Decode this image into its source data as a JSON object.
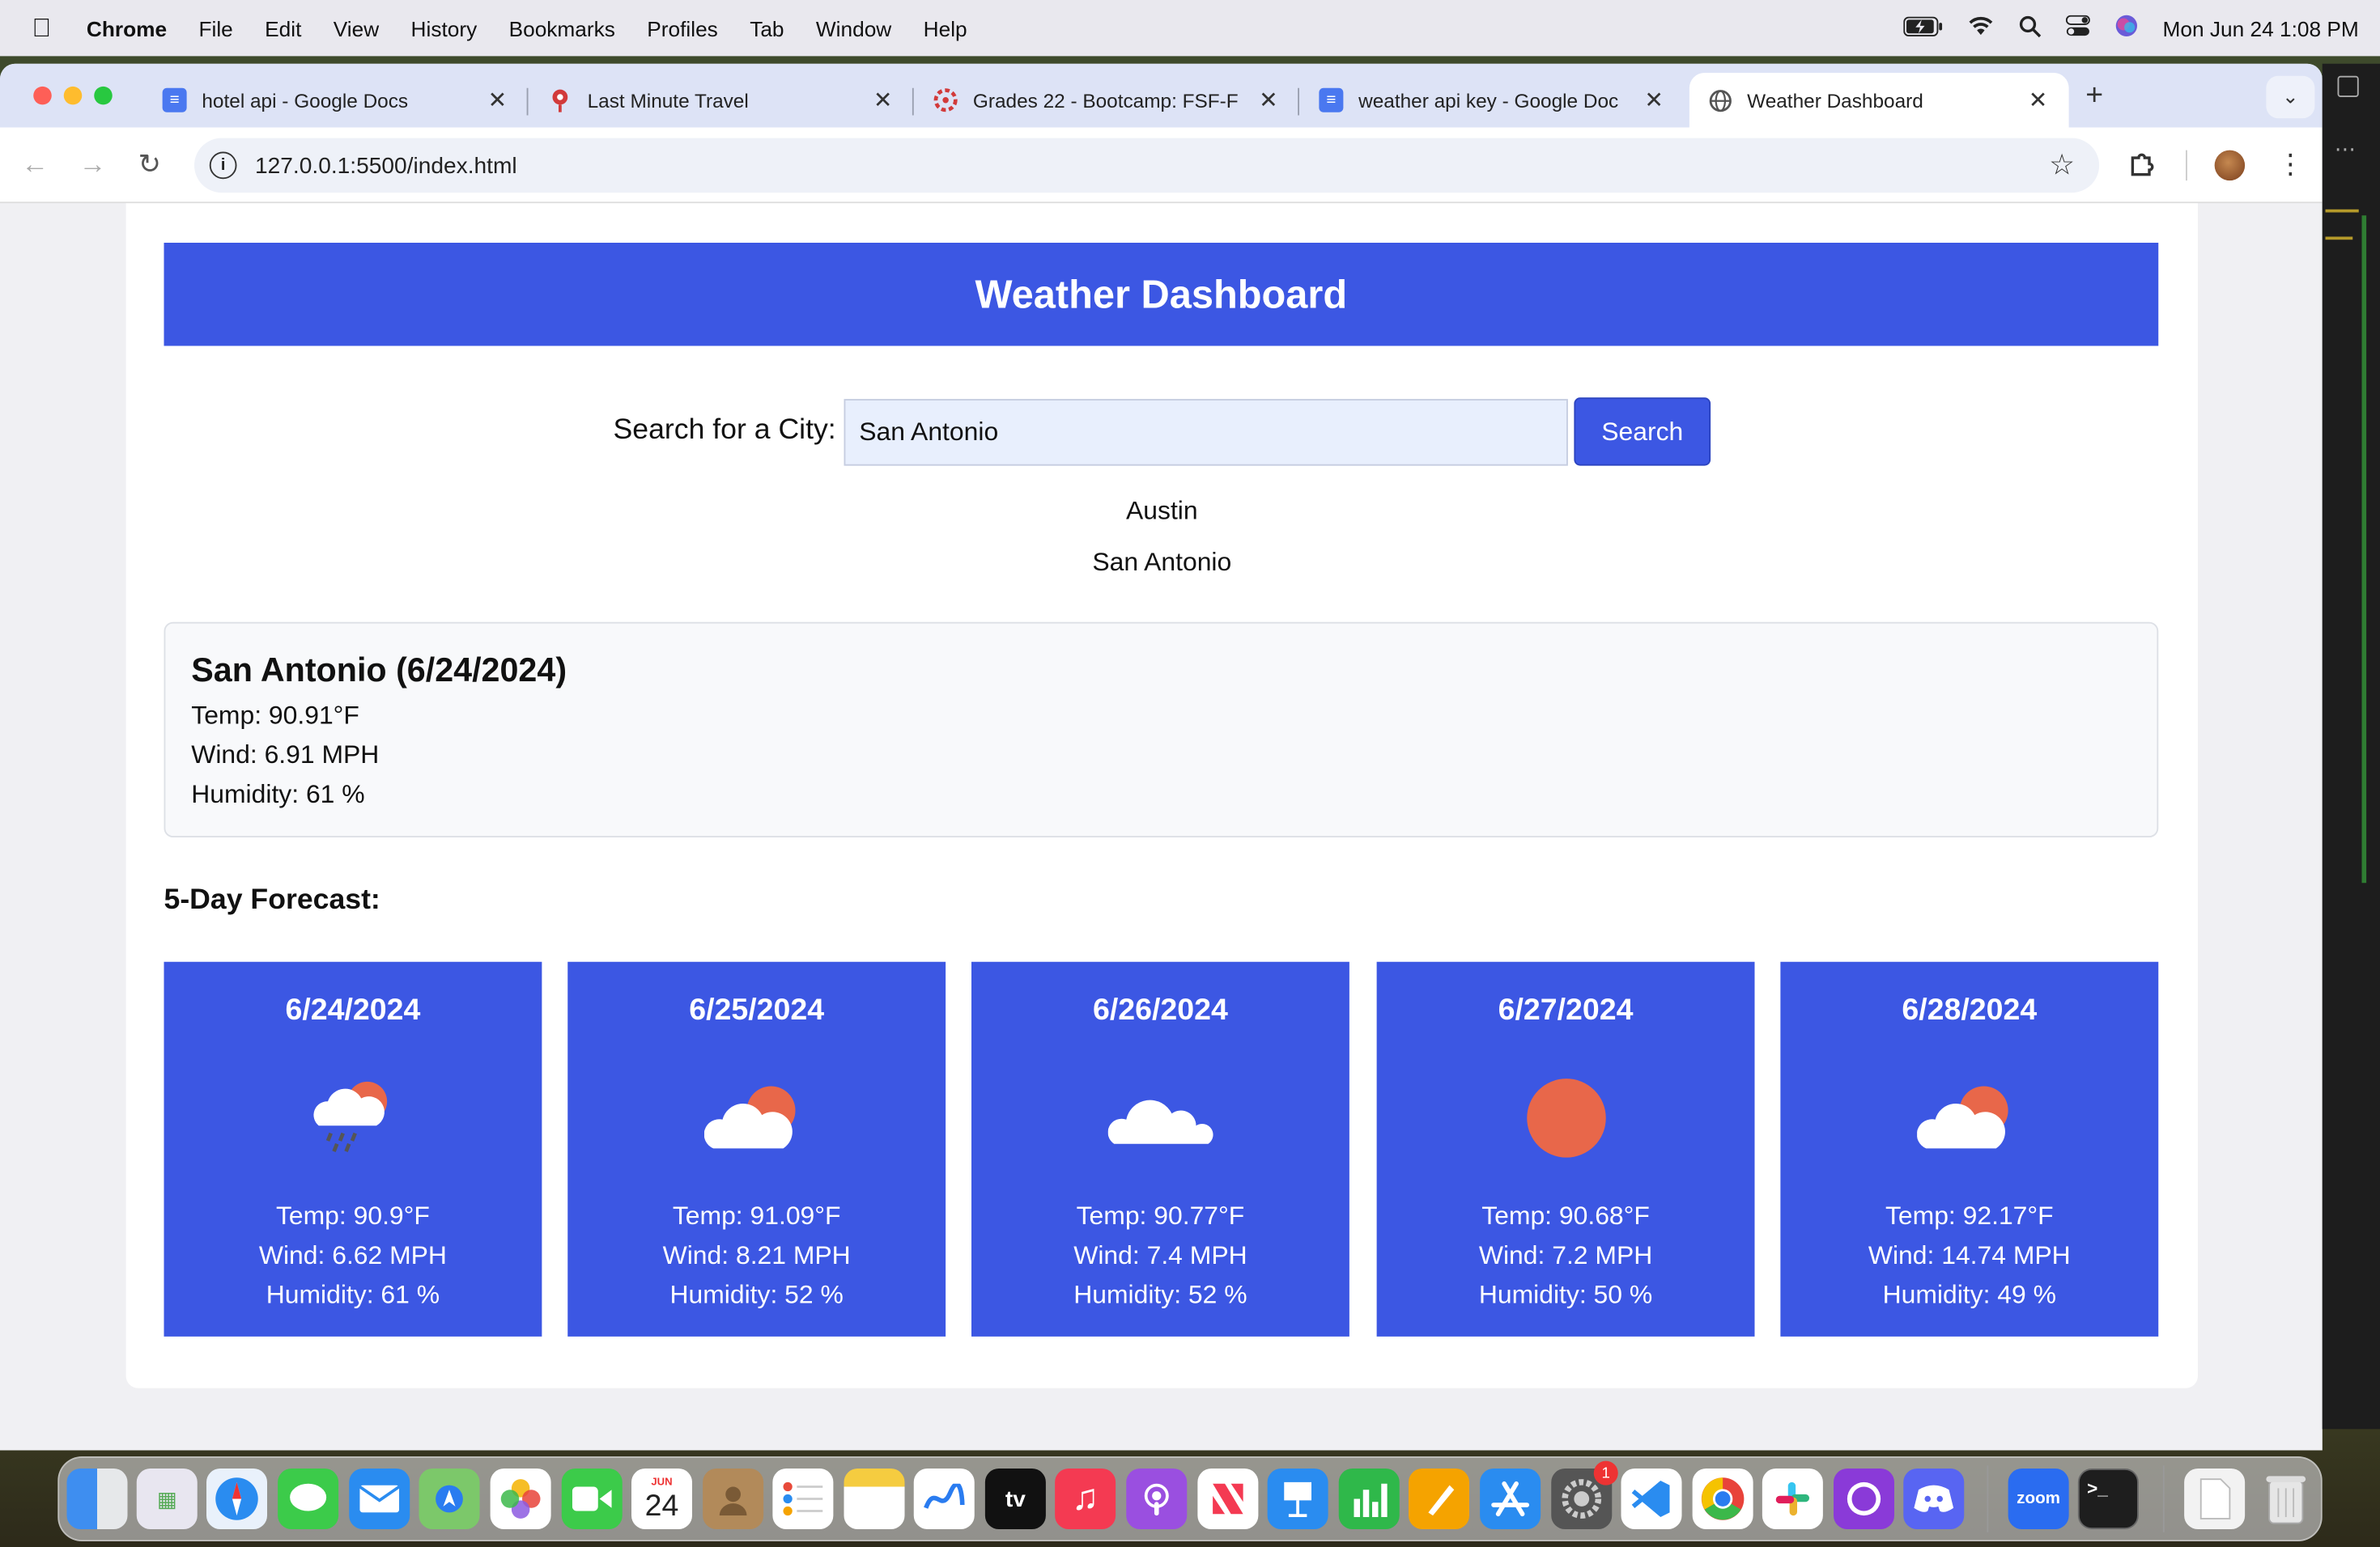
{
  "menubar": {
    "app": "Chrome",
    "items": [
      "File",
      "Edit",
      "View",
      "History",
      "Bookmarks",
      "Profiles",
      "Tab",
      "Window",
      "Help"
    ],
    "clock": "Mon Jun 24  1:08 PM"
  },
  "tabs": [
    {
      "title": "hotel api - Google Docs",
      "color": "#4a78f0"
    },
    {
      "title": "Last Minute Travel",
      "color": "#d23a3a"
    },
    {
      "title": "Grades 22 - Bootcamp: FSF-F",
      "color": "#d23a3a"
    },
    {
      "title": "weather api key - Google Doc",
      "color": "#4a78f0"
    },
    {
      "title": "Weather Dashboard",
      "color": "#555555"
    }
  ],
  "address": {
    "url": "127.0.0.1:5500/index.html"
  },
  "page": {
    "title": "Weather Dashboard",
    "search": {
      "label": "Search for a City:",
      "value": "San Antonio",
      "button": "Search"
    },
    "history": [
      "Austin",
      "San Antonio"
    ],
    "current": {
      "heading": "San Antonio (6/24/2024)",
      "temp": "Temp: 90.91°F",
      "wind": "Wind: 6.91 MPH",
      "humidity": "Humidity: 61 %"
    },
    "forecast_title": "5-Day Forecast:",
    "forecast": [
      {
        "date": "6/24/2024",
        "icon": "rain-cloud-sun-icon",
        "temp": "Temp: 90.9°F",
        "wind": "Wind: 6.62 MPH",
        "humidity": "Humidity: 61 %"
      },
      {
        "date": "6/25/2024",
        "icon": "cloud-sun-icon",
        "temp": "Temp: 91.09°F",
        "wind": "Wind: 8.21 MPH",
        "humidity": "Humidity: 52 %"
      },
      {
        "date": "6/26/2024",
        "icon": "cloud-icon",
        "temp": "Temp: 90.77°F",
        "wind": "Wind: 7.4 MPH",
        "humidity": "Humidity: 52 %"
      },
      {
        "date": "6/27/2024",
        "icon": "sun-icon",
        "temp": "Temp: 90.68°F",
        "wind": "Wind: 7.2 MPH",
        "humidity": "Humidity: 50 %"
      },
      {
        "date": "6/28/2024",
        "icon": "cloud-sun-icon",
        "temp": "Temp: 92.17°F",
        "wind": "Wind: 14.74 MPH",
        "humidity": "Humidity: 49 %"
      }
    ]
  },
  "colors": {
    "accent": "#3c57e3",
    "sun": "#e8674a"
  },
  "dock": {
    "calendar_month": "JUN",
    "calendar_day": "24",
    "tv_label": "tv",
    "zoom_label": "zoom",
    "badge": "1",
    "apps": [
      "finder-icon",
      "launchpad-icon",
      "safari-icon",
      "messages-icon",
      "mail-icon",
      "maps-icon",
      "photos-icon",
      "facetime-icon",
      "calendar-icon",
      "contacts-icon",
      "reminders-icon",
      "notes-icon",
      "freeform-icon",
      "apple-tv-icon",
      "music-icon",
      "podcasts-icon",
      "news-icon",
      "keynote-icon",
      "numbers-icon",
      "pages-icon",
      "app-store-icon",
      "system-settings-icon",
      "vscode-icon",
      "chrome-icon",
      "slack-icon",
      "github-desktop-icon",
      "discord-icon",
      "zoom-icon",
      "terminal-icon",
      "document-icon",
      "trash-icon"
    ]
  }
}
